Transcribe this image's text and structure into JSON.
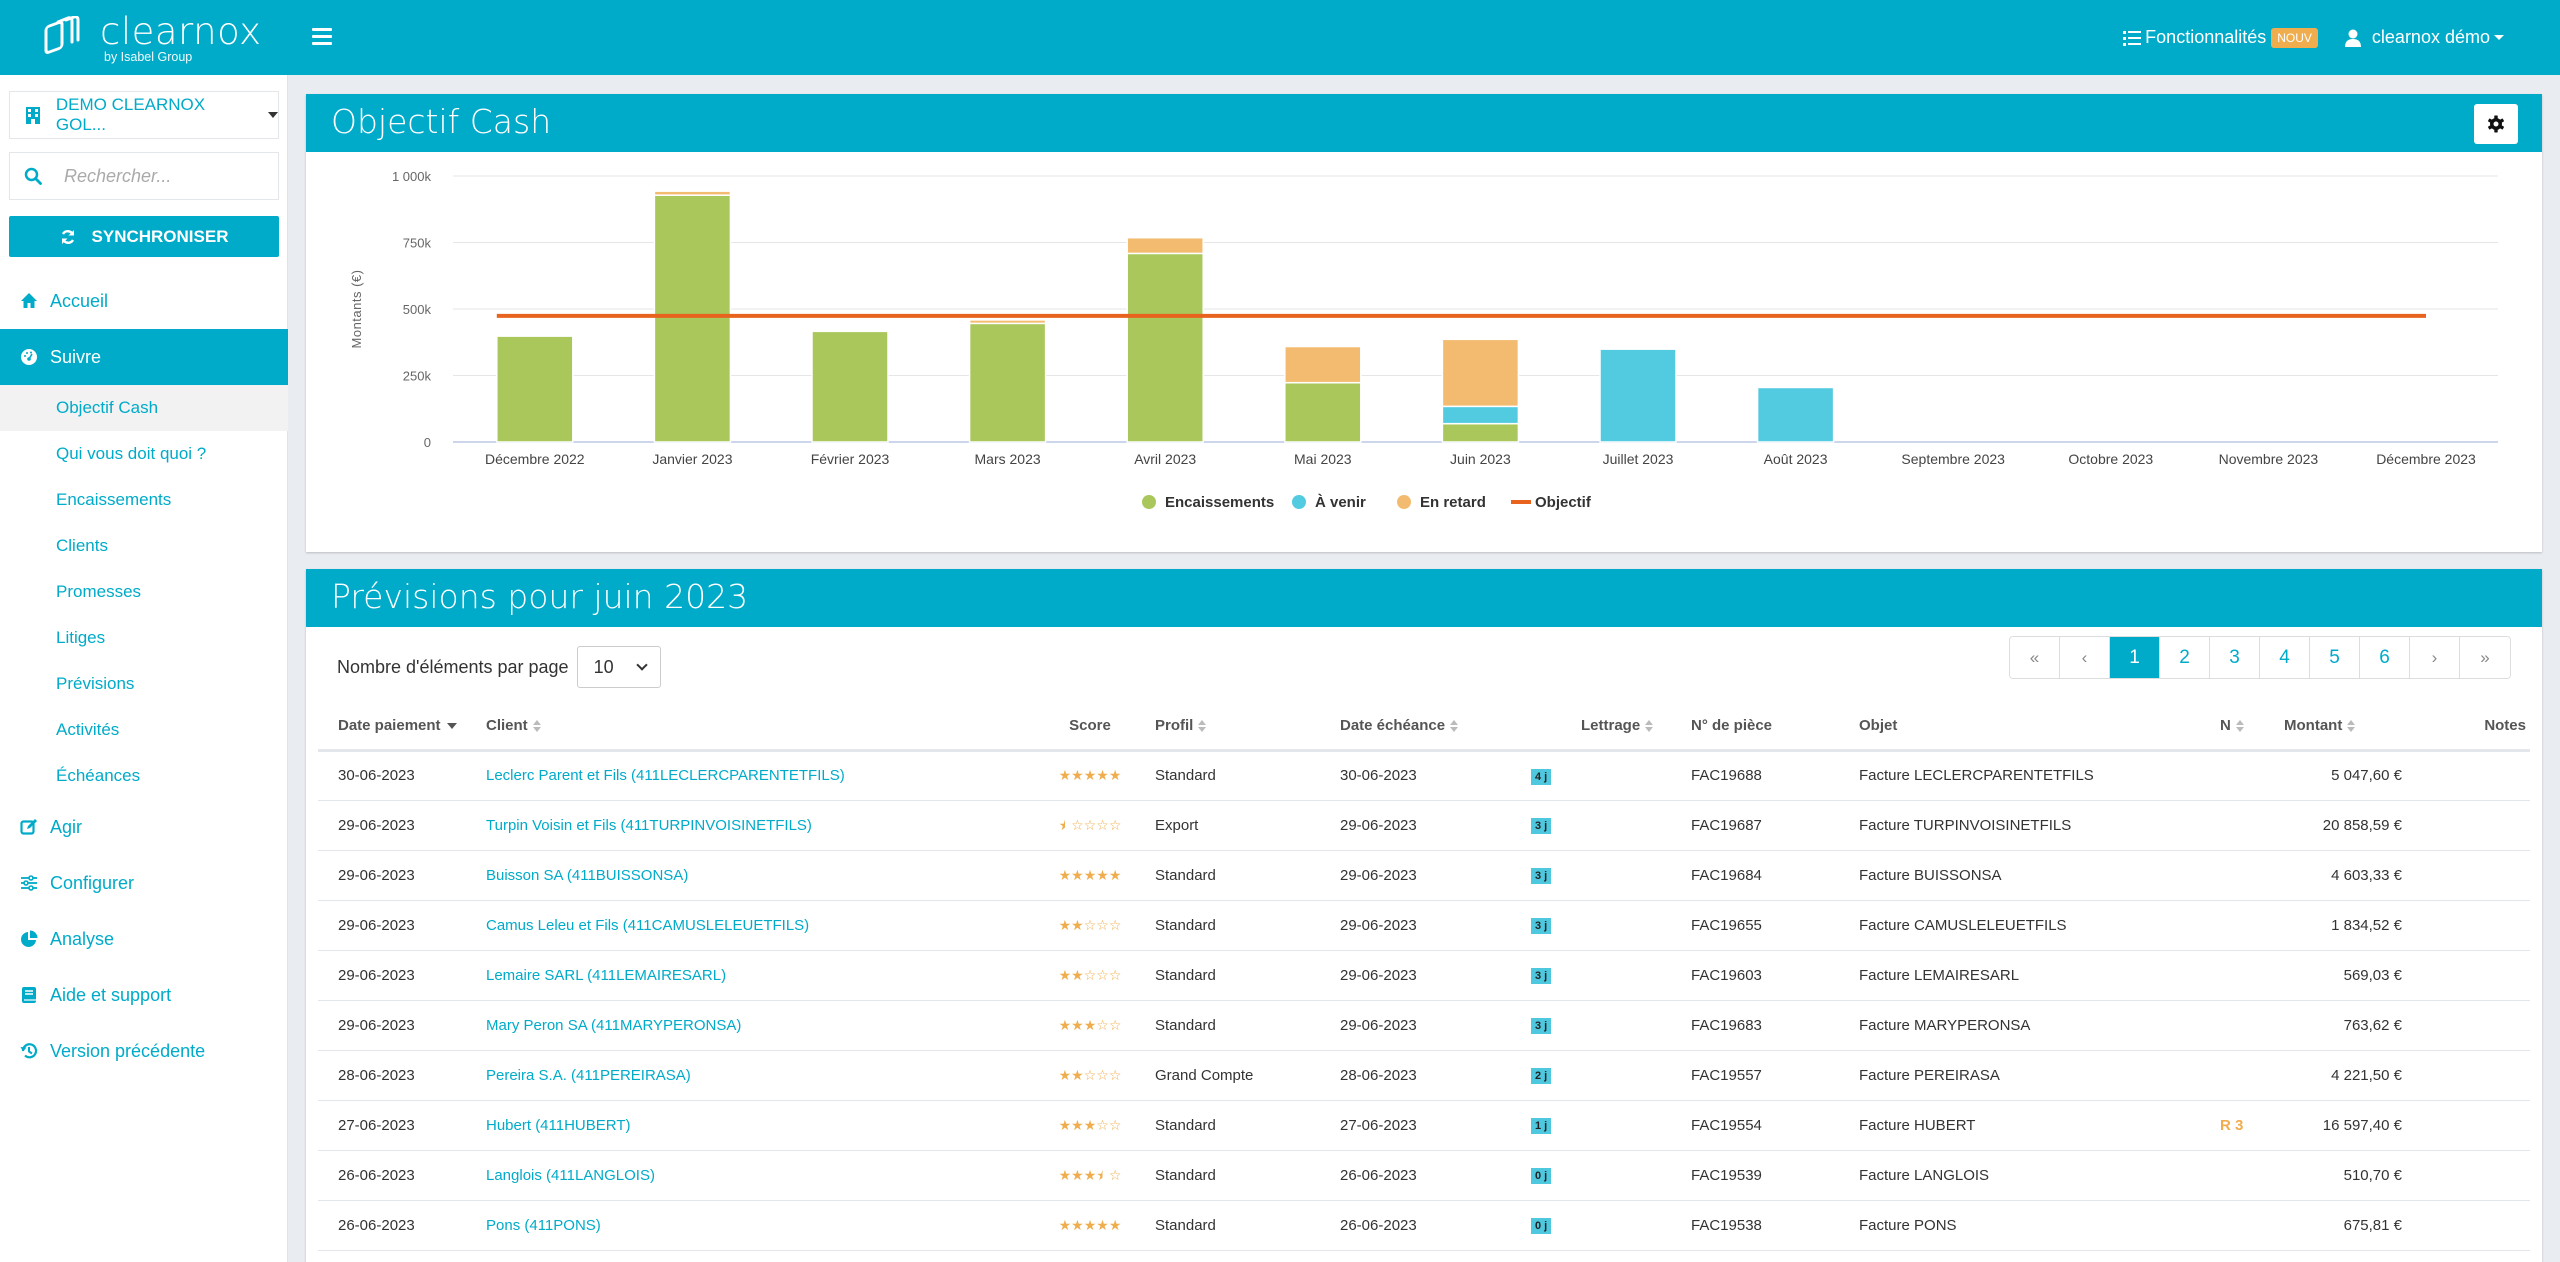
{
  "topbar": {
    "logo_text": "clearnox",
    "logo_sub": "by Isabel Group",
    "features_label": "Fonctionnalités",
    "features_badge": "NOUV",
    "user_label": "clearnox démo"
  },
  "sidebar": {
    "company": "DEMO CLEARNOX GOL...",
    "search_placeholder": "Rechercher...",
    "sync_label": "SYNCHRONISER",
    "items": [
      {
        "label": "Accueil",
        "icon": "home-icon"
      },
      {
        "label": "Suivre",
        "icon": "dashboard-icon",
        "active": true
      },
      {
        "label": "Agir",
        "icon": "edit-icon"
      },
      {
        "label": "Configurer",
        "icon": "sliders-icon"
      },
      {
        "label": "Analyse",
        "icon": "pie-chart-icon"
      },
      {
        "label": "Aide et support",
        "icon": "book-icon"
      },
      {
        "label": "Version précédente",
        "icon": "history-icon"
      }
    ],
    "sub_items": [
      {
        "label": "Objectif Cash",
        "active": true
      },
      {
        "label": "Qui vous doit quoi ?"
      },
      {
        "label": "Encaissements"
      },
      {
        "label": "Clients"
      },
      {
        "label": "Promesses"
      },
      {
        "label": "Litiges"
      },
      {
        "label": "Prévisions"
      },
      {
        "label": "Activités"
      },
      {
        "label": "Échéances"
      }
    ]
  },
  "chart_card": {
    "title": "Objectif Cash"
  },
  "chart_data": {
    "type": "bar",
    "stacked": true,
    "title": "Objectif Cash",
    "xlabel": "",
    "ylabel": "Montants (€)",
    "ylim": [
      0,
      1000000
    ],
    "yticks": [
      0,
      250000,
      500000,
      750000,
      1000000
    ],
    "ytick_labels": [
      "0",
      "250k",
      "500k",
      "750k",
      "1 000k"
    ],
    "grid": true,
    "legend_position": "bottom",
    "categories": [
      "Décembre 2022",
      "Janvier 2023",
      "Février 2023",
      "Mars 2023",
      "Avril 2023",
      "Mai 2023",
      "Juin 2023",
      "Juillet 2023",
      "Août 2023",
      "Septembre 2023",
      "Octobre 2023",
      "Novembre 2023",
      "Décembre 2023"
    ],
    "series": [
      {
        "name": "Encaissements",
        "color": "#a9c75a",
        "values": [
          398000,
          928000,
          416000,
          446000,
          709000,
          223000,
          69000,
          0,
          0,
          0,
          0,
          0,
          0
        ]
      },
      {
        "name": "À venir",
        "color": "#52cae0",
        "values": [
          0,
          0,
          0,
          0,
          0,
          0,
          65000,
          349000,
          205000,
          0,
          0,
          0,
          0
        ]
      },
      {
        "name": "En retard",
        "color": "#f3bb6f",
        "values": [
          0,
          15000,
          0,
          13000,
          59000,
          136000,
          252000,
          0,
          0,
          0,
          0,
          0,
          0
        ]
      }
    ],
    "line": {
      "name": "Objectif",
      "color": "#e8641e",
      "value": 474000
    }
  },
  "table_card": {
    "title": "Prévisions pour juin 2023",
    "per_page_label": "Nombre d'éléments par page",
    "per_page_value": "10",
    "pagination": [
      "«",
      "‹",
      "1",
      "2",
      "3",
      "4",
      "5",
      "6",
      "›",
      "»"
    ],
    "current_page": "1",
    "columns": [
      "Date paiement",
      "Client",
      "Score",
      "Profil",
      "Date échéance",
      "Lettrage",
      "N° de pièce",
      "Objet",
      "N",
      "Montant",
      "Notes"
    ],
    "rows": [
      {
        "date": "30-06-2023",
        "client": "Leclerc Parent et Fils (411LECLERCPARENTETFILS)",
        "score": 5,
        "profil": "Standard",
        "echeance": "30-06-2023",
        "delay": "4 j",
        "lettrage": "",
        "piece": "FAC19688",
        "objet": "Facture LECLERCPARENTETFILS",
        "n": "",
        "montant": "5 047,60 €",
        "notes": ""
      },
      {
        "date": "29-06-2023",
        "client": "Turpin Voisin et Fils (411TURPINVOISINETFILS)",
        "score": 0.5,
        "profil": "Export",
        "echeance": "29-06-2023",
        "delay": "3 j",
        "lettrage": "",
        "piece": "FAC19687",
        "objet": "Facture TURPINVOISINETFILS",
        "n": "",
        "montant": "20 858,59 €",
        "notes": ""
      },
      {
        "date": "29-06-2023",
        "client": "Buisson SA (411BUISSONSA)",
        "score": 5,
        "profil": "Standard",
        "echeance": "29-06-2023",
        "delay": "3 j",
        "lettrage": "",
        "piece": "FAC19684",
        "objet": "Facture BUISSONSA",
        "n": "",
        "montant": "4 603,33 €",
        "notes": ""
      },
      {
        "date": "29-06-2023",
        "client": "Camus Leleu et Fils (411CAMUSLELEUETFILS)",
        "score": 2,
        "profil": "Standard",
        "echeance": "29-06-2023",
        "delay": "3 j",
        "lettrage": "",
        "piece": "FAC19655",
        "objet": "Facture CAMUSLELEUETFILS",
        "n": "",
        "montant": "1 834,52 €",
        "notes": ""
      },
      {
        "date": "29-06-2023",
        "client": "Lemaire SARL (411LEMAIRESARL)",
        "score": 2,
        "profil": "Standard",
        "echeance": "29-06-2023",
        "delay": "3 j",
        "lettrage": "",
        "piece": "FAC19603",
        "objet": "Facture LEMAIRESARL",
        "n": "",
        "montant": "569,03 €",
        "notes": ""
      },
      {
        "date": "29-06-2023",
        "client": "Mary Peron SA (411MARYPERONSA)",
        "score": 3,
        "profil": "Standard",
        "echeance": "29-06-2023",
        "delay": "3 j",
        "lettrage": "",
        "piece": "FAC19683",
        "objet": "Facture MARYPERONSA",
        "n": "",
        "montant": "763,62 €",
        "notes": ""
      },
      {
        "date": "28-06-2023",
        "client": "Pereira S.A. (411PEREIRASA)",
        "score": 2,
        "profil": "Grand Compte",
        "echeance": "28-06-2023",
        "delay": "2 j",
        "lettrage": "",
        "piece": "FAC19557",
        "objet": "Facture PEREIRASA",
        "n": "",
        "montant": "4 221,50 €",
        "notes": ""
      },
      {
        "date": "27-06-2023",
        "client": "Hubert (411HUBERT)",
        "score": 3,
        "profil": "Standard",
        "echeance": "27-06-2023",
        "delay": "1 j",
        "lettrage": "",
        "piece": "FAC19554",
        "objet": "Facture HUBERT",
        "n": "R 3",
        "montant": "16 597,40 €",
        "notes": ""
      },
      {
        "date": "26-06-2023",
        "client": "Langlois (411LANGLOIS)",
        "score": 3.5,
        "profil": "Standard",
        "echeance": "26-06-2023",
        "delay": "0 j",
        "lettrage": "",
        "piece": "FAC19539",
        "objet": "Facture LANGLOIS",
        "n": "",
        "montant": "510,70 €",
        "notes": ""
      },
      {
        "date": "26-06-2023",
        "client": "Pons (411PONS)",
        "score": 5,
        "profil": "Standard",
        "echeance": "26-06-2023",
        "delay": "0 j",
        "lettrage": "",
        "piece": "FAC19538",
        "objet": "Facture PONS",
        "n": "",
        "montant": "675,81 €",
        "notes": ""
      }
    ]
  },
  "colors": {
    "brand": "#00abc9",
    "badge": "#f0ad4e"
  }
}
